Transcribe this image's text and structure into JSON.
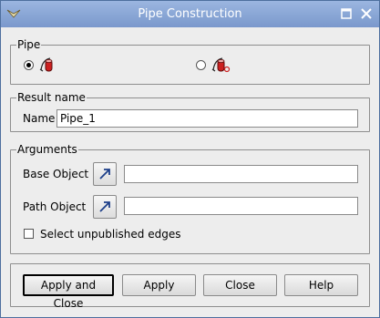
{
  "window": {
    "title": "Pipe Construction"
  },
  "pipe_group": {
    "legend": "Pipe",
    "modes": [
      {
        "icon": "pipe-simple-icon",
        "selected": true
      },
      {
        "icon": "pipe-with-profile-icon",
        "selected": false
      }
    ]
  },
  "result_group": {
    "legend": "Result name",
    "name_label": "Name",
    "name_value": "Pipe_1"
  },
  "arguments_group": {
    "legend": "Arguments",
    "base_label": "Base Object",
    "base_value": "",
    "path_label": "Path Object",
    "path_value": "",
    "unpublished_label": "Select unpublished edges",
    "unpublished_checked": false
  },
  "buttons": {
    "apply_close": "Apply and Close",
    "apply": "Apply",
    "close": "Close",
    "help": "Help"
  },
  "colors": {
    "titlebar": "#8aa8d8",
    "icon_red": "#cc1f1f"
  }
}
